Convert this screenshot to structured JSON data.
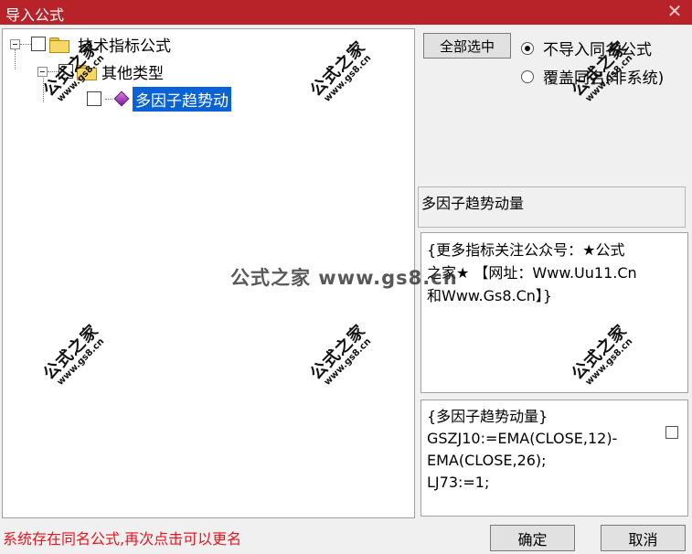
{
  "window": {
    "title": "导入公式",
    "close_glyph": "✕",
    "close_icon": "close-icon"
  },
  "tree": {
    "root": {
      "label": "技术指标公式",
      "checked": false,
      "expanded": true
    },
    "group": {
      "label": "其他类型",
      "checked": false,
      "expanded": true
    },
    "item": {
      "label": "多因子趋势动",
      "checked": false,
      "selected": true
    }
  },
  "controls": {
    "select_all_label": "全部选中",
    "radio_options": [
      {
        "label": "不导入同名公式",
        "selected": true
      },
      {
        "label": "覆盖同名(非系统)",
        "selected": false
      }
    ]
  },
  "description": "多因子趋势动量",
  "note_lines": [
    "{更多指标关注公众号：★公式",
    "之家★ 【网址：Www.Uu11.Cn",
    "和Www.Gs8.Cn】}"
  ],
  "code_lines": [
    "{多因子趋势动量}",
    "GSZJ10:=EMA(CLOSE,12)-",
    "EMA(CLOSE,26);",
    "LJ73:=1;"
  ],
  "status_message": "系统存在同名公式,再次点击可以更名",
  "buttons": {
    "ok_label": "确定",
    "cancel_label": "取消"
  },
  "watermark": {
    "big": "公式之家",
    "small": "www.gs8.cn",
    "center": "公式之家 www.gs8.cn"
  },
  "colors": {
    "titlebar": "#b8232a",
    "selection": "#0a63d6",
    "status_text": "#e8141e"
  }
}
